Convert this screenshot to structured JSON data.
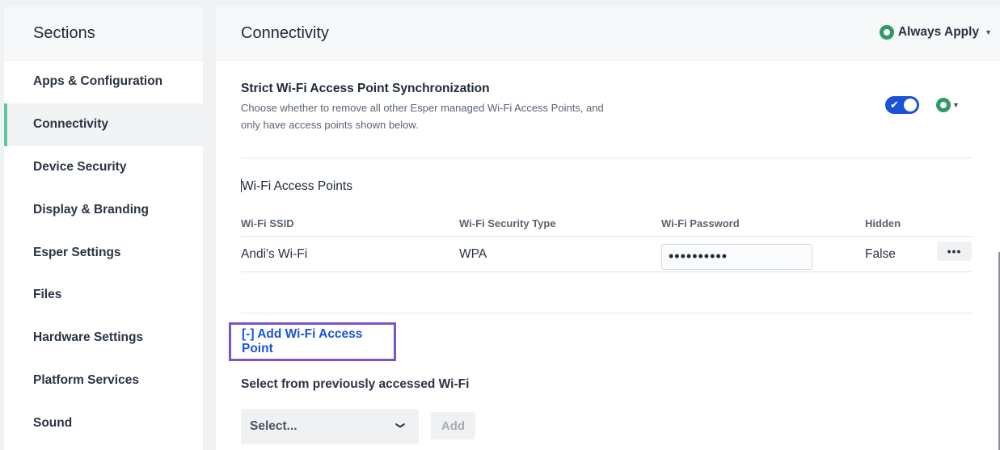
{
  "sidebar": {
    "title": "Sections",
    "items": [
      {
        "label": "Apps & Configuration",
        "active": false
      },
      {
        "label": "Connectivity",
        "active": true
      },
      {
        "label": "Device Security",
        "active": false
      },
      {
        "label": "Display & Branding",
        "active": false
      },
      {
        "label": "Esper Settings",
        "active": false
      },
      {
        "label": "Files",
        "active": false
      },
      {
        "label": "Hardware Settings",
        "active": false
      },
      {
        "label": "Platform Services",
        "active": false
      },
      {
        "label": "Sound",
        "active": false
      }
    ]
  },
  "main": {
    "title": "Connectivity",
    "apply_mode": "Always Apply",
    "strict_sync": {
      "title": "Strict Wi-Fi Access Point Synchronization",
      "description": "Choose whether to remove all other Esper managed Wi-Fi Access Points, and only have access points shown below.",
      "enabled": true
    },
    "wifi_section_title": "Wi-Fi Access Points",
    "table": {
      "headers": [
        "Wi-Fi SSID",
        "Wi-Fi Security Type",
        "Wi-Fi Password",
        "Hidden"
      ],
      "rows": [
        {
          "ssid": "Andi's Wi-Fi",
          "security": "WPA",
          "password_masked": "••••••••••",
          "hidden": "False",
          "more": "•••"
        }
      ]
    },
    "add_link": "[-] Add Wi-Fi Access Point",
    "select_label": "Select from previously accessed Wi-Fi",
    "select_placeholder": "Select...",
    "add_button": "Add"
  },
  "colors": {
    "accent_green": "#5cc79b",
    "apply_green": "#2f9a62",
    "toggle_blue": "#1a53d6",
    "link_blue": "#1a53d6",
    "highlight_purple": "#7a55c7"
  },
  "icons": [
    "target-icon",
    "caret-down-icon",
    "check-icon",
    "more-icon",
    "chevron-down-icon"
  ]
}
